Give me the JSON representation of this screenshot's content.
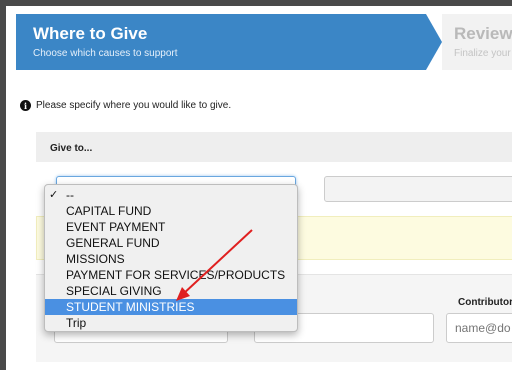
{
  "steps": [
    {
      "title": "Where to Give",
      "subtitle": "Choose which causes to support"
    },
    {
      "title": "Review",
      "subtitle": "Finalize your"
    }
  ],
  "info": {
    "icon": "info-circle-icon",
    "text": "Please specify where you would like to give."
  },
  "give": {
    "label": "Give to..."
  },
  "dropdown": {
    "options": [
      "--",
      "CAPITAL FUND",
      "EVENT PAYMENT",
      "GENERAL FUND",
      "MISSIONS",
      "PAYMENT FOR SERVICES/PRODUCTS",
      "SPECIAL GIVING",
      "STUDENT MINISTRIES",
      "Trip"
    ],
    "checked_option": "--",
    "highlighted_option": "STUDENT MINISTRIES"
  },
  "contributor": {
    "label": "Contributor's",
    "name_placeholder": "ame",
    "email_placeholder": "name@do"
  },
  "colors": {
    "accent": "#3b86c6",
    "highlight": "#4a90e2",
    "arrow": "#e02020"
  }
}
